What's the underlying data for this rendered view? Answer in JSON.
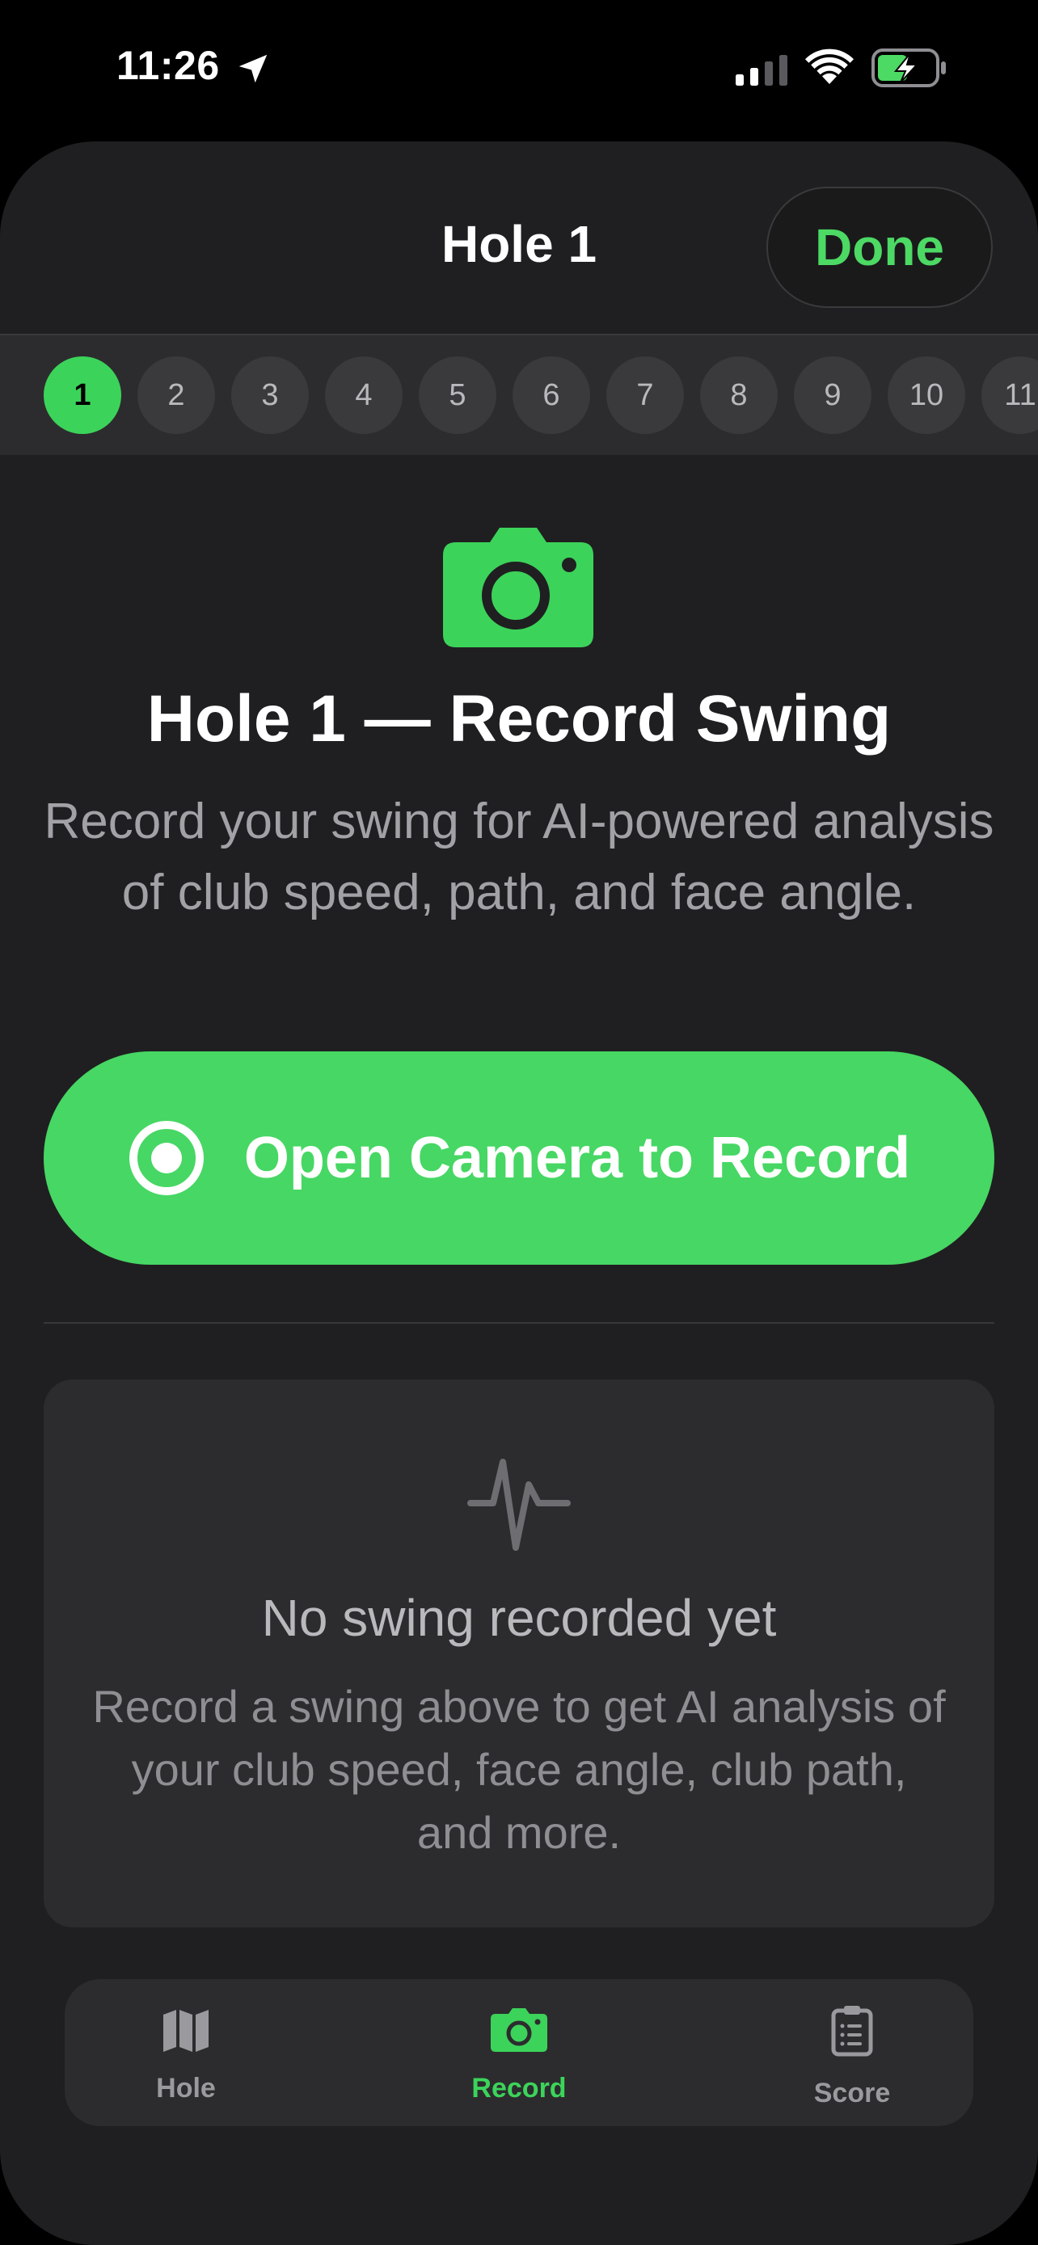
{
  "status_bar": {
    "time": "11:26"
  },
  "sheet": {
    "title": "Hole 1",
    "done_label": "Done"
  },
  "holes": [
    {
      "label": "1",
      "active": true
    },
    {
      "label": "2"
    },
    {
      "label": "3"
    },
    {
      "label": "4"
    },
    {
      "label": "5"
    },
    {
      "label": "6"
    },
    {
      "label": "7"
    },
    {
      "label": "8"
    },
    {
      "label": "9"
    },
    {
      "label": "10"
    },
    {
      "label": "11"
    }
  ],
  "record": {
    "title": "Hole 1 — Record Swing",
    "description": "Record your swing for AI-powered analysis of club speed, path, and face angle.",
    "button_label": "Open Camera to Record"
  },
  "empty_state": {
    "title": "No swing recorded yet",
    "description": "Record a swing above to get AI analysis of your club speed, face angle, club path, and more."
  },
  "tabs": [
    {
      "label": "Hole",
      "icon": "map-icon"
    },
    {
      "label": "Record",
      "icon": "camera-icon",
      "active": true
    },
    {
      "label": "Score",
      "icon": "clipboard-icon"
    }
  ],
  "colors": {
    "accent": "#3cd35a",
    "button": "#47d764",
    "background": "#1f1f21",
    "card": "#2c2c2e"
  }
}
